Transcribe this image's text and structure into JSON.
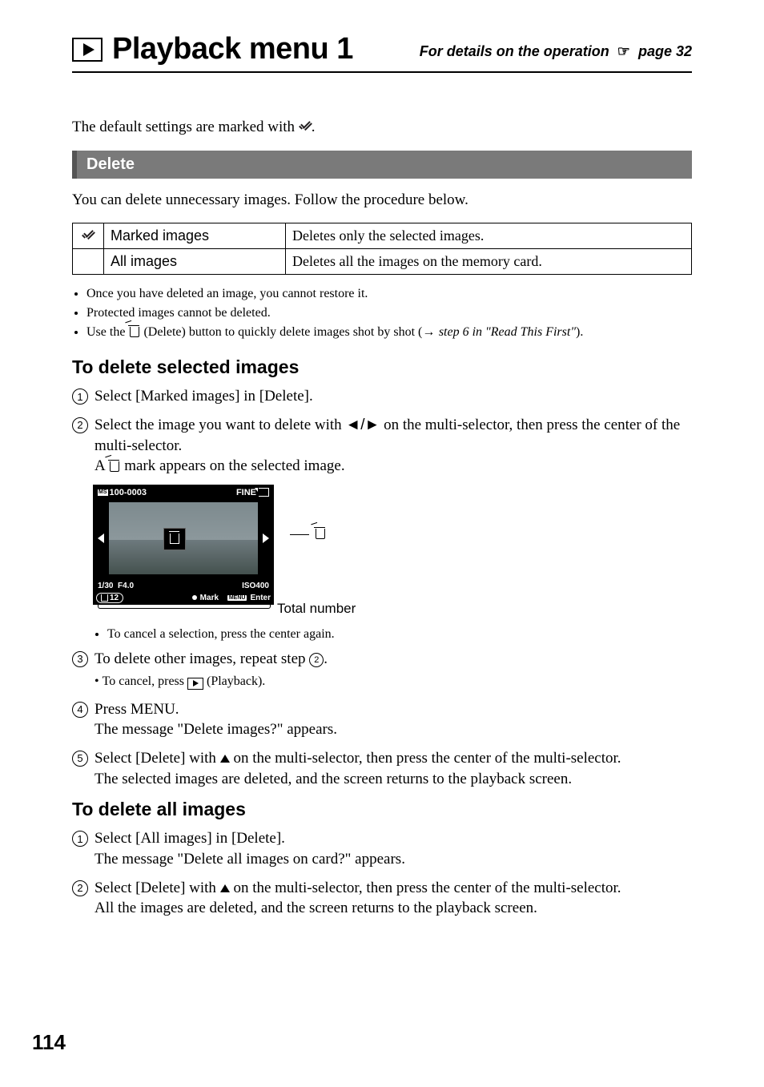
{
  "header": {
    "title": "Playback menu 1",
    "rightPrefix": "For details on the operation",
    "rightSuffix": "page 32"
  },
  "intro": "The default settings are marked with ",
  "sectionTitle": "Delete",
  "sectionIntro": "You can delete unnecessary images. Follow the procedure below.",
  "table": {
    "row1": {
      "label": "Marked images",
      "desc": "Deletes only the selected images."
    },
    "row2": {
      "label": "All images",
      "desc": "Deletes all the images on the memory card."
    }
  },
  "notes": {
    "n1": "Once you have deleted an image, you cannot restore it.",
    "n2": "Protected images cannot be deleted.",
    "n3a": "Use the ",
    "n3b": " (Delete) button to quickly delete images shot by shot (",
    "n3c": "step 6 in \"Read This First\"",
    "n3d": ")."
  },
  "sub1": "To delete selected images",
  "steps1": {
    "s1": "Select [Marked images] in [Delete].",
    "s2a": "Select the image you want to delete with ",
    "s2b": " on the multi-selector, then press the center of the multi-selector.",
    "s2c": "A ",
    "s2d": " mark appears on the selected image.",
    "s2cancel": "To cancel a selection, press the center again.",
    "s3a": "To delete other images, repeat step ",
    "s3b": ".",
    "s3cancel": "To cancel, press ",
    "s3cancel2": " (Playback).",
    "s4a": "Press MENU.",
    "s4b": "The message \"Delete images?\" appears.",
    "s5a": "Select [Delete] with ",
    "s5b": " on the multi-selector, then press the center of the multi-selector.",
    "s5c": "The selected images are deleted, and the screen returns to the playback screen."
  },
  "illus": {
    "folder": "100-0003",
    "fine": "FINE",
    "shutter": "1/30",
    "fnum": "F4.0",
    "iso": "ISO400",
    "count": "12",
    "mark": "Mark",
    "enter": "Enter",
    "menu": "MENU",
    "totalLabel": "Total number"
  },
  "sub2": "To delete all images",
  "steps2": {
    "s1a": "Select [All images] in [Delete].",
    "s1b": "The message \"Delete all images on card?\" appears.",
    "s2a": "Select [Delete] with ",
    "s2b": " on the multi-selector, then press the center of the multi-selector.",
    "s2c": "All the images are deleted, and the screen returns to the playback screen."
  },
  "pageNumber": "114"
}
